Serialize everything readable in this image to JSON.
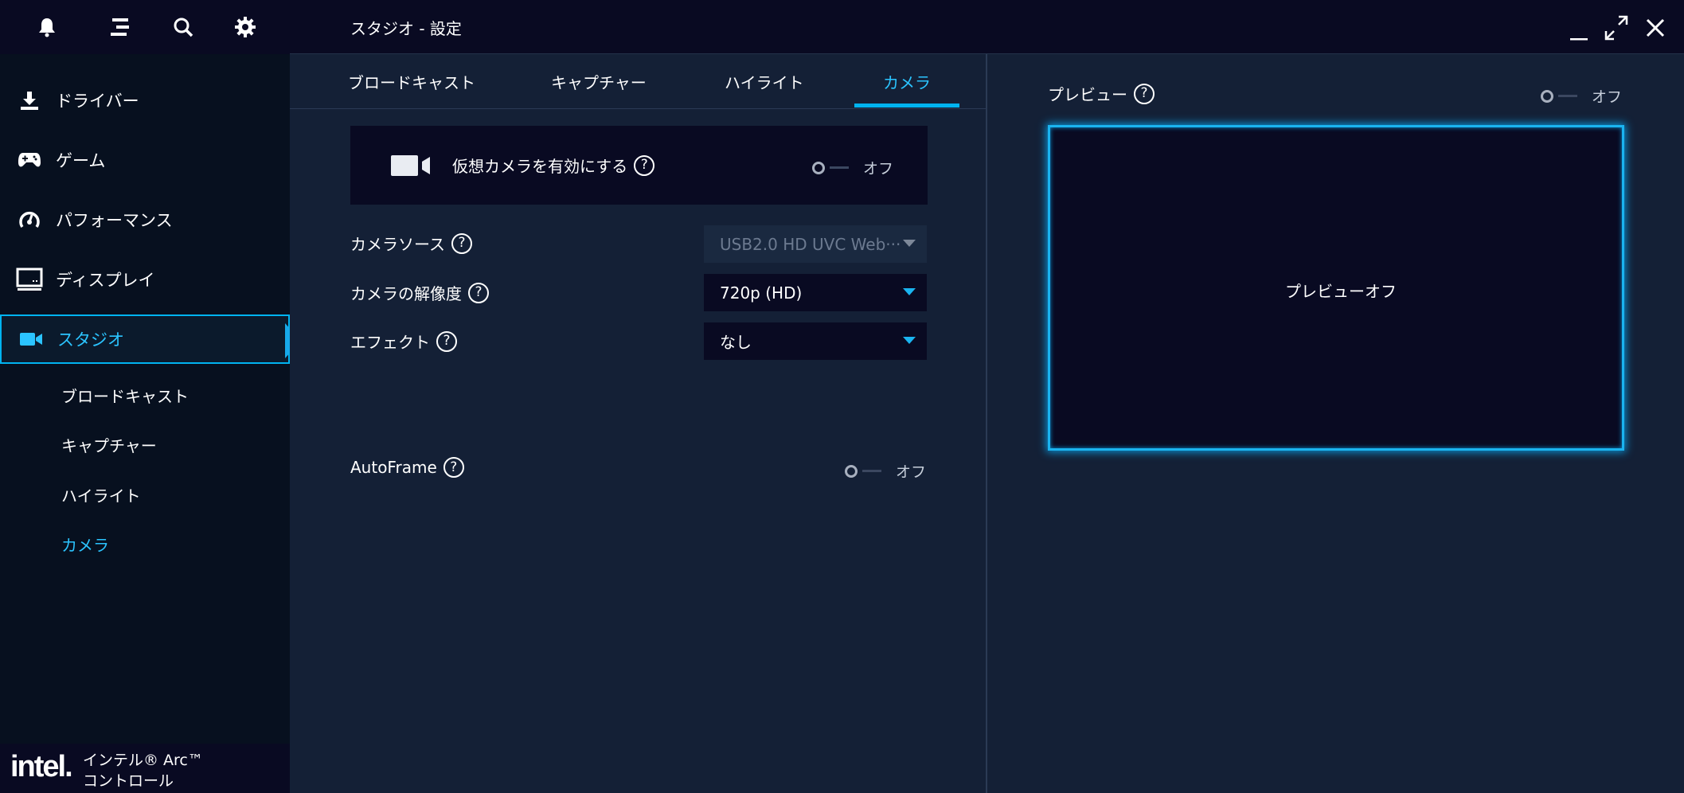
{
  "sidebar": {
    "top_icons": [
      "bell-icon",
      "menu-icon",
      "search-icon",
      "gear-icon"
    ],
    "items": [
      {
        "label": "ドライバー",
        "icon": "download-icon"
      },
      {
        "label": "ゲーム",
        "icon": "gamepad-icon"
      },
      {
        "label": "パフォーマンス",
        "icon": "gauge-icon"
      },
      {
        "label": "ディスプレイ",
        "icon": "monitor-icon"
      },
      {
        "label": "スタジオ",
        "icon": "camera-icon",
        "active": true
      }
    ],
    "sub_items": [
      "ブロードキャスト",
      "キャプチャー",
      "ハイライト",
      "カメラ"
    ],
    "active_sub_item": "カメラ",
    "brand": {
      "logo": "intel.",
      "line1": "インテル® Arc™",
      "line2": "コントロール"
    }
  },
  "titlebar": {
    "title": "スタジオ - 設定",
    "buttons": [
      "minimize-icon",
      "expand-icon",
      "close-icon"
    ]
  },
  "tabs": {
    "items": [
      "ブロードキャスト",
      "キャプチャー",
      "ハイライト",
      "カメラ"
    ],
    "active": "カメラ"
  },
  "camera": {
    "virtual_camera": {
      "label": "仮想カメラを有効にする",
      "state": "オフ"
    },
    "source": {
      "label": "カメラソース",
      "value": "USB2.0 HD UVC Web···"
    },
    "resolution": {
      "label": "カメラの解像度",
      "value": "720p (HD)"
    },
    "effect": {
      "label": "エフェクト",
      "value": "なし"
    },
    "autoframe": {
      "label": "AutoFrame",
      "state": "オフ"
    },
    "help_glyph": "?"
  },
  "preview": {
    "label": "プレビュー",
    "state": "オフ",
    "placeholder": "プレビューオフ"
  },
  "colors": {
    "accent": "#1ab4f0",
    "active_text": "#2bc4ff",
    "background": "#142036",
    "dark_panel": "#090a22"
  }
}
